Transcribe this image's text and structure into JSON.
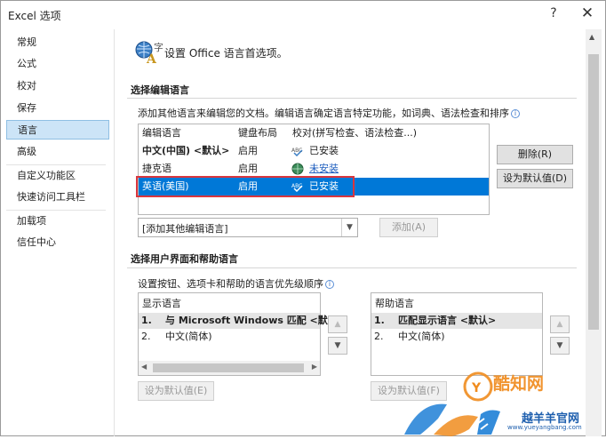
{
  "window": {
    "title": "Excel 选项",
    "help_glyph": "?",
    "close_glyph": "✕"
  },
  "nav": {
    "items": [
      {
        "label": "常规"
      },
      {
        "label": "公式"
      },
      {
        "label": "校对"
      },
      {
        "label": "保存"
      },
      {
        "label": "语言",
        "selected": true
      },
      {
        "label": "高级"
      },
      {
        "label": "自定义功能区"
      },
      {
        "label": "快速访问工具栏"
      },
      {
        "label": "加载项"
      },
      {
        "label": "信任中心"
      }
    ]
  },
  "header": {
    "text": "设置 Office 语言首选项。",
    "icon": "language-options-icon"
  },
  "editing": {
    "section_title": "选择编辑语言",
    "description": "添加其他语言来编辑您的文档。编辑语言确定语言特定功能，如词典、语法检查和排序",
    "columns": [
      "编辑语言",
      "键盘布局",
      "校对(拼写检查、语法检查...)"
    ],
    "rows": [
      {
        "language": "中文(中国) <默认>",
        "keyboard": "启用",
        "proofing": "已安装",
        "bold": true
      },
      {
        "language": "捷克语",
        "keyboard": "启用",
        "proofing": "未安装",
        "link": true
      },
      {
        "language": "英语(美国)",
        "keyboard": "启用",
        "proofing": "已安装",
        "selected": true
      }
    ],
    "delete_button": "删除(R)",
    "default_button": "设为默认值(D)",
    "add_combo_value": "[添加其他编辑语言]",
    "add_button": "添加(A)"
  },
  "ui_lang": {
    "section_title": "选择用户界面和帮助语言",
    "description": "设置按钮、选项卡和帮助的语言优先级顺序",
    "display": {
      "header": "显示语言",
      "items": [
        {
          "num": "1.",
          "text": "与 Microsoft Windows 匹配 <默",
          "bold": true,
          "selected": true
        },
        {
          "num": "2.",
          "text": "中文(简体)"
        }
      ],
      "default_button": "设为默认值(E)"
    },
    "help": {
      "header": "帮助语言",
      "items": [
        {
          "num": "1.",
          "text": "匹配显示语言 <默认>",
          "bold": true,
          "selected": true
        },
        {
          "num": "2.",
          "text": "中文(简体)"
        }
      ],
      "default_button": "设为默认值(F)"
    },
    "up_glyph": "▲",
    "down_glyph": "▼"
  },
  "watermark": {
    "brand": "酷知网",
    "site_text": "越羊羊官网",
    "url": "www.yueyangbang.com"
  },
  "colors": {
    "selection": "#0078d7",
    "highlight_box": "#d9363e",
    "link": "#1f5fbf",
    "nav_selected": "#cce4f7"
  }
}
